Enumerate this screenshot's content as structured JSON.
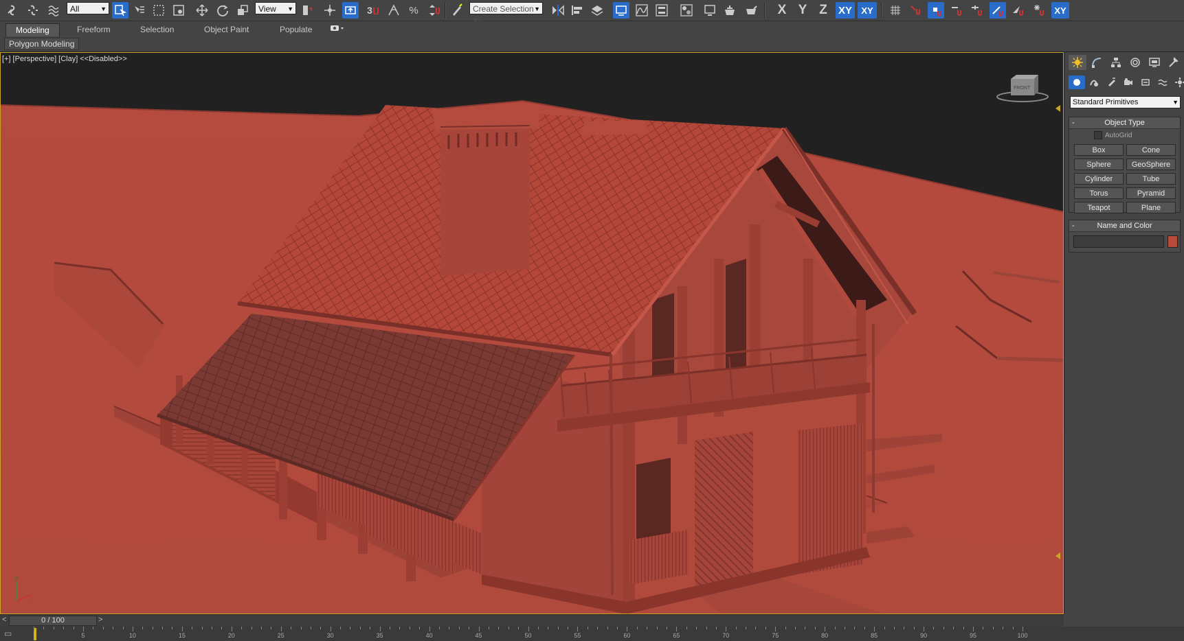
{
  "toolbar": {
    "selection_filter": "All",
    "ref_coord_system": "View",
    "named_selection_placeholder": "Create Selection Se",
    "snap_label": "3",
    "axis_constraints": [
      "X",
      "Y",
      "Z",
      "XY",
      "XY"
    ]
  },
  "ribbon": {
    "tabs": [
      "Modeling",
      "Freeform",
      "Selection",
      "Object Paint",
      "Populate"
    ],
    "active_tab": "Modeling",
    "panel_label": "Polygon Modeling"
  },
  "viewport": {
    "label_parts": [
      "[+]",
      "[Perspective]",
      "[Clay]",
      "<<Disabled>>"
    ],
    "viewcube_label": "FRONT",
    "background_color": "#222222",
    "clay_color": "#b04a3c"
  },
  "command_panel": {
    "category_dropdown": "Standard Primitives",
    "object_type": {
      "title": "Object Type",
      "autogrid_label": "AutoGrid",
      "buttons": [
        "Box",
        "Cone",
        "Sphere",
        "GeoSphere",
        "Cylinder",
        "Tube",
        "Torus",
        "Pyramid",
        "Teapot",
        "Plane"
      ]
    },
    "name_and_color": {
      "title": "Name and Color",
      "name_value": "",
      "color": "#b84a3a"
    }
  },
  "timeline": {
    "slider_text": "0 / 100",
    "prev_label": "<",
    "next_label": ">",
    "ticks": [
      "5",
      "10",
      "15",
      "20",
      "25",
      "30",
      "35",
      "40",
      "45",
      "50",
      "55",
      "60",
      "65",
      "70",
      "75",
      "80",
      "85",
      "90",
      "95",
      "100"
    ]
  }
}
